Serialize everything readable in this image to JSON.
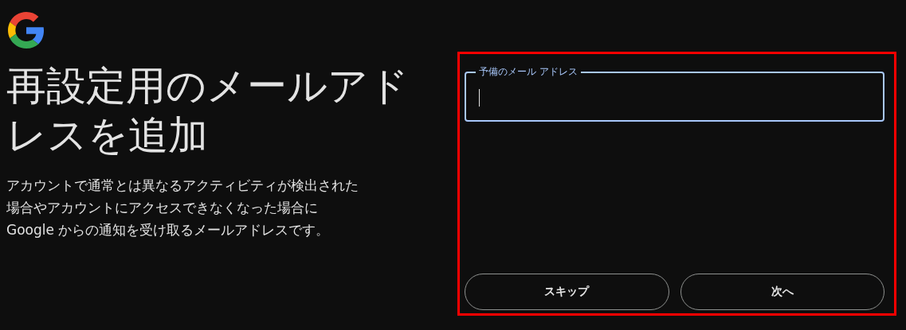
{
  "heading": "再設定用のメールアドレスを追加",
  "description": "アカウントで通常とは異なるアクティビティが検出された場合やアカウントにアクセスできなくなった場合に Google からの通知を受け取るメールアドレスです。",
  "highlighted": true,
  "email_field": {
    "label": "予備のメール アドレス",
    "focused": true
  },
  "buttons": [
    {
      "label": "スキップ"
    },
    {
      "label": "次へ"
    }
  ]
}
